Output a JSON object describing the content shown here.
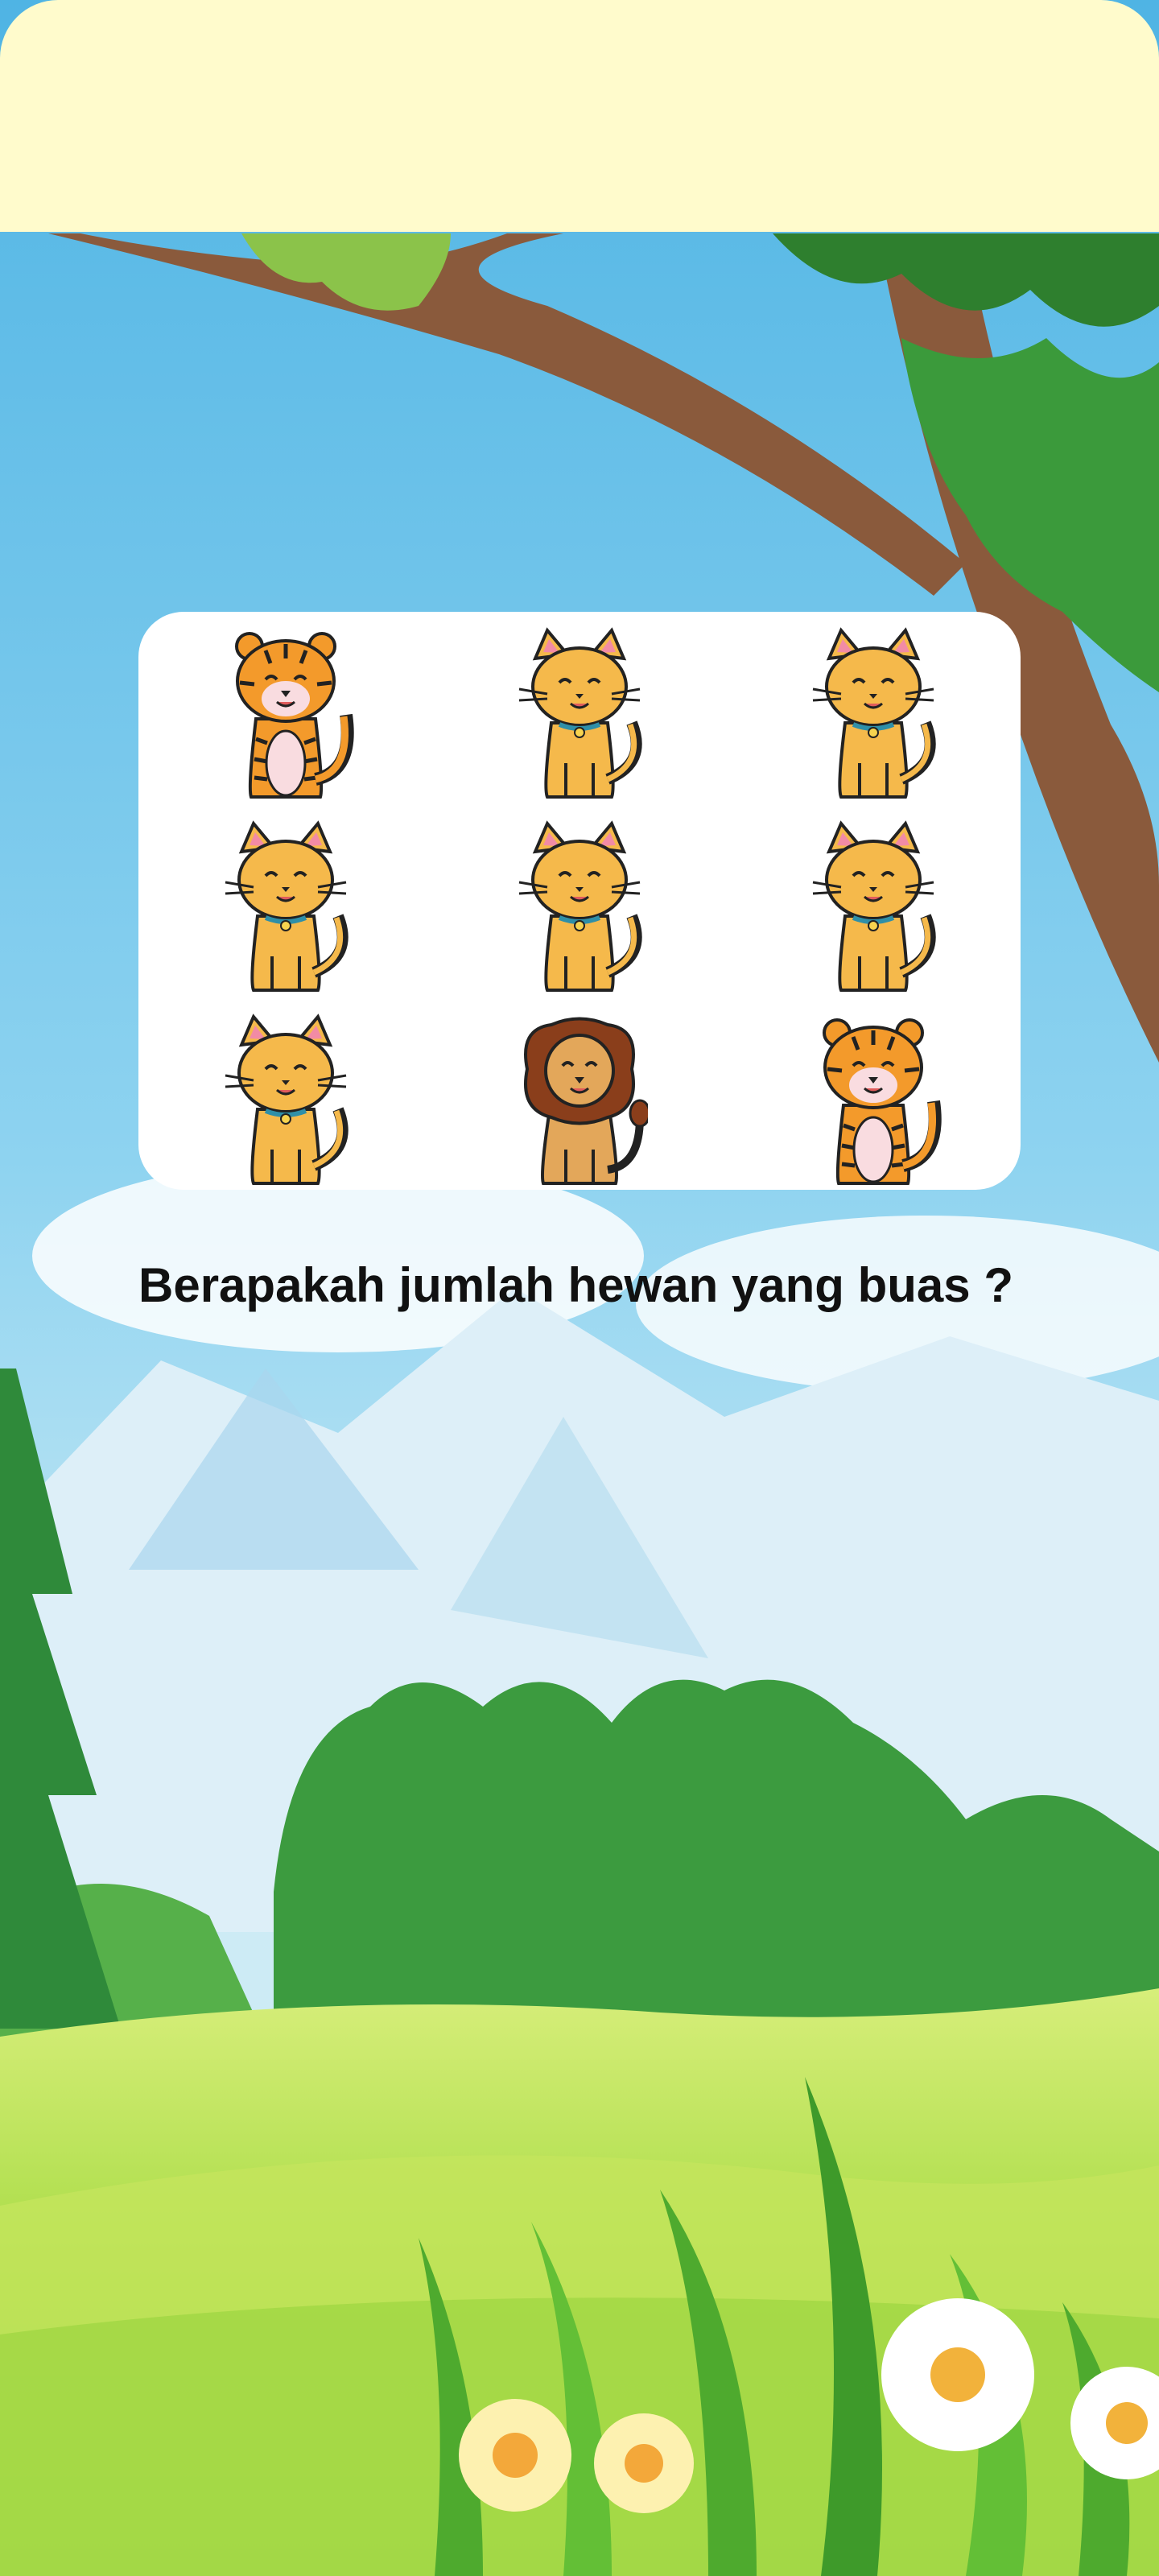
{
  "colors": {
    "topbar": "#FFFBCC",
    "sky_top": "#58B9E6",
    "sky_bottom": "#BDE6F4",
    "mountain": "#E8F4FA",
    "grass": "#9FD84A",
    "tree": "#3E9A3A"
  },
  "grid": {
    "animals": [
      {
        "kind": "tiger"
      },
      {
        "kind": "cat"
      },
      {
        "kind": "cat"
      },
      {
        "kind": "cat"
      },
      {
        "kind": "cat"
      },
      {
        "kind": "cat"
      },
      {
        "kind": "cat"
      },
      {
        "kind": "lion"
      },
      {
        "kind": "tiger"
      }
    ]
  },
  "question": "Berapakah jumlah hewan yang buas ?"
}
